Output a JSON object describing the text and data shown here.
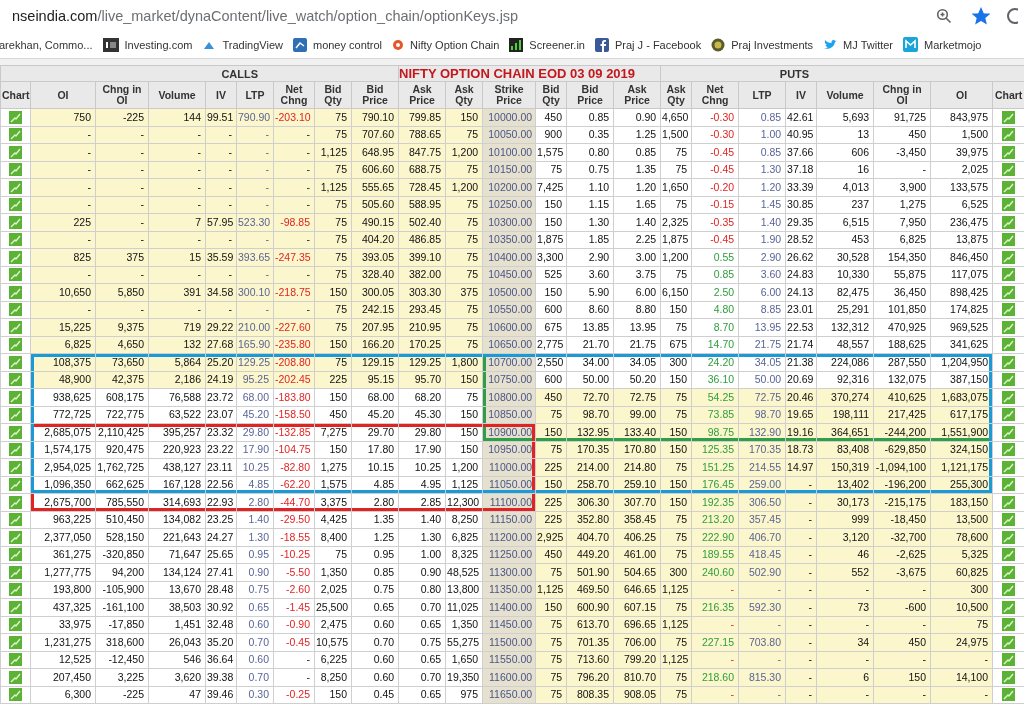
{
  "browser": {
    "url_host": "nseindia.com",
    "url_path": "/live_market/dynaContent/live_watch/option_chain/optionKeys.jsp",
    "bookmarked": true,
    "bookmarks": [
      "arekhan, Commo...",
      "Investing.com",
      "TradingView",
      "money control",
      "Nifty Option Chain",
      "Screener.in",
      "Praj J - Facebook",
      "Praj Investments",
      "MJ Twitter",
      "Marketmojo"
    ]
  },
  "table": {
    "calls_label": "CALLS",
    "title": "NIFTY OPTION CHAIN EOD 03 09 2019",
    "puts_label": "PUTS",
    "columns": [
      "Chart",
      "OI",
      "Chng in\nOI",
      "Volume",
      "IV",
      "LTP",
      "Net\nChng",
      "Bid\nQty",
      "Bid\nPrice",
      "Ask\nPrice",
      "Ask\nQty",
      "Strike\nPrice",
      "Bid\nQty",
      "Bid\nPrice",
      "Ask\nPrice",
      "Ask\nQty",
      "Net\nChng",
      "LTP",
      "IV",
      "Volume",
      "Chng in\nOI",
      "OI",
      "Chart"
    ],
    "rows": [
      {
        "calls_shaded": true,
        "puts_shaded": false,
        "call_net_red": true,
        "put_net_green": false,
        "outlined": [
          false,
          false,
          false
        ],
        "strike": "10000.00",
        "calls": [
          "750",
          "-225",
          "144",
          "99.51",
          "790.90",
          "-203.10",
          "75",
          "790.10",
          "799.85",
          "150"
        ],
        "puts": [
          "450",
          "0.85",
          "0.90",
          "4,650",
          "-0.30",
          "0.85",
          "42.61",
          "5,693",
          "91,725",
          "843,975"
        ]
      },
      {
        "calls_shaded": true,
        "puts_shaded": false,
        "call_net_red": false,
        "put_net_green": false,
        "outlined": [
          false,
          false,
          false
        ],
        "strike": "10050.00",
        "calls": [
          "-",
          "-",
          "-",
          "-",
          "-",
          "-",
          "75",
          "707.60",
          "788.65",
          "75"
        ],
        "puts": [
          "900",
          "0.35",
          "1.25",
          "1,500",
          "-0.30",
          "1.00",
          "40.95",
          "13",
          "450",
          "1,500"
        ]
      },
      {
        "calls_shaded": true,
        "puts_shaded": false,
        "call_net_red": false,
        "put_net_green": false,
        "outlined": [
          false,
          false,
          false
        ],
        "strike": "10100.00",
        "calls": [
          "-",
          "-",
          "-",
          "-",
          "-",
          "-",
          "1,125",
          "648.95",
          "847.75",
          "1,200"
        ],
        "puts": [
          "1,575",
          "0.80",
          "0.85",
          "75",
          "-0.45",
          "0.85",
          "37.66",
          "606",
          "-3,450",
          "39,975"
        ]
      },
      {
        "calls_shaded": true,
        "puts_shaded": false,
        "call_net_red": false,
        "put_net_green": false,
        "outlined": [
          false,
          false,
          false
        ],
        "strike": "10150.00",
        "calls": [
          "-",
          "-",
          "-",
          "-",
          "-",
          "-",
          "75",
          "606.60",
          "688.75",
          "75"
        ],
        "puts": [
          "75",
          "0.75",
          "1.35",
          "75",
          "-0.45",
          "1.30",
          "37.18",
          "16",
          "-",
          "2,025"
        ]
      },
      {
        "calls_shaded": true,
        "puts_shaded": false,
        "call_net_red": false,
        "put_net_green": false,
        "outlined": [
          false,
          false,
          false
        ],
        "strike": "10200.00",
        "calls": [
          "-",
          "-",
          "-",
          "-",
          "-",
          "-",
          "1,125",
          "555.65",
          "728.45",
          "1,200"
        ],
        "puts": [
          "7,425",
          "1.10",
          "1.20",
          "1,650",
          "-0.20",
          "1.20",
          "33.39",
          "4,013",
          "3,900",
          "133,575"
        ]
      },
      {
        "calls_shaded": true,
        "puts_shaded": false,
        "call_net_red": false,
        "put_net_green": false,
        "outlined": [
          false,
          false,
          false
        ],
        "strike": "10250.00",
        "calls": [
          "-",
          "-",
          "-",
          "-",
          "-",
          "-",
          "75",
          "505.60",
          "588.95",
          "75"
        ],
        "puts": [
          "150",
          "1.15",
          "1.65",
          "75",
          "-0.15",
          "1.45",
          "30.85",
          "237",
          "1,275",
          "6,525"
        ]
      },
      {
        "calls_shaded": true,
        "puts_shaded": false,
        "call_net_red": true,
        "put_net_green": false,
        "outlined": [
          false,
          false,
          false
        ],
        "strike": "10300.00",
        "calls": [
          "225",
          "-",
          "7",
          "57.95",
          "523.30",
          "-98.85",
          "75",
          "490.15",
          "502.40",
          "75"
        ],
        "puts": [
          "150",
          "1.30",
          "1.40",
          "2,325",
          "-0.35",
          "1.40",
          "29.35",
          "6,515",
          "7,950",
          "236,475"
        ]
      },
      {
        "calls_shaded": true,
        "puts_shaded": false,
        "call_net_red": false,
        "put_net_green": false,
        "outlined": [
          false,
          false,
          false
        ],
        "strike": "10350.00",
        "calls": [
          "-",
          "-",
          "-",
          "-",
          "-",
          "-",
          "75",
          "404.20",
          "486.85",
          "75"
        ],
        "puts": [
          "1,875",
          "1.85",
          "2.25",
          "1,875",
          "-0.45",
          "1.90",
          "28.52",
          "453",
          "6,825",
          "13,875"
        ]
      },
      {
        "calls_shaded": true,
        "puts_shaded": false,
        "call_net_red": true,
        "put_net_green": true,
        "outlined": [
          false,
          false,
          false
        ],
        "strike": "10400.00",
        "calls": [
          "825",
          "375",
          "15",
          "35.59",
          "393.65",
          "-247.35",
          "75",
          "393.05",
          "399.10",
          "75"
        ],
        "puts": [
          "3,300",
          "2.90",
          "3.00",
          "1,200",
          "0.55",
          "2.90",
          "26.62",
          "30,528",
          "154,350",
          "846,450"
        ]
      },
      {
        "calls_shaded": true,
        "puts_shaded": false,
        "call_net_red": false,
        "put_net_green": true,
        "outlined": [
          false,
          false,
          false
        ],
        "strike": "10450.00",
        "calls": [
          "-",
          "-",
          "-",
          "-",
          "-",
          "-",
          "75",
          "328.40",
          "382.00",
          "75"
        ],
        "puts": [
          "525",
          "3.60",
          "3.75",
          "75",
          "0.85",
          "3.60",
          "24.83",
          "10,330",
          "55,875",
          "117,075"
        ]
      },
      {
        "calls_shaded": true,
        "puts_shaded": false,
        "call_net_red": true,
        "put_net_green": true,
        "outlined": [
          false,
          false,
          false
        ],
        "strike": "10500.00",
        "calls": [
          "10,650",
          "5,850",
          "391",
          "34.58",
          "300.10",
          "-218.75",
          "150",
          "300.05",
          "303.30",
          "375"
        ],
        "puts": [
          "150",
          "5.90",
          "6.00",
          "6,150",
          "2.50",
          "6.00",
          "24.13",
          "82,475",
          "36,450",
          "898,425"
        ]
      },
      {
        "calls_shaded": true,
        "puts_shaded": false,
        "call_net_red": false,
        "put_net_green": true,
        "outlined": [
          false,
          false,
          false
        ],
        "strike": "10550.00",
        "calls": [
          "-",
          "-",
          "-",
          "-",
          "-",
          "-",
          "75",
          "242.15",
          "293.45",
          "75"
        ],
        "puts": [
          "600",
          "8.60",
          "8.80",
          "150",
          "4.80",
          "8.85",
          "23.01",
          "25,291",
          "101,850",
          "174,825"
        ]
      },
      {
        "calls_shaded": true,
        "puts_shaded": false,
        "call_net_red": true,
        "put_net_green": true,
        "outlined": [
          false,
          false,
          false
        ],
        "strike": "10600.00",
        "calls": [
          "15,225",
          "9,375",
          "719",
          "29.22",
          "210.00",
          "-227.60",
          "75",
          "207.95",
          "210.95",
          "75"
        ],
        "puts": [
          "675",
          "13.85",
          "13.95",
          "75",
          "8.70",
          "13.95",
          "22.53",
          "132,312",
          "470,925",
          "969,525"
        ]
      },
      {
        "calls_shaded": true,
        "puts_shaded": false,
        "call_net_red": true,
        "put_net_green": true,
        "outlined": [
          false,
          false,
          false
        ],
        "strike": "10650.00",
        "calls": [
          "6,825",
          "4,650",
          "132",
          "27.68",
          "165.90",
          "-235.80",
          "150",
          "166.20",
          "170.25",
          "75"
        ],
        "puts": [
          "2,775",
          "21.70",
          "21.75",
          "675",
          "14.70",
          "21.75",
          "21.74",
          "48,557",
          "188,625",
          "341,625"
        ]
      },
      {
        "calls_shaded": true,
        "puts_shaded": false,
        "call_net_red": true,
        "put_net_green": true,
        "outlined": [
          true,
          false,
          true
        ],
        "strike": "10700.00",
        "calls": [
          "108,375",
          "73,650",
          "5,864",
          "25.20",
          "129.25",
          "-208.80",
          "75",
          "129.15",
          "129.25",
          "1,800"
        ],
        "puts": [
          "2,550",
          "34.00",
          "34.05",
          "300",
          "24.20",
          "34.05",
          "21.38",
          "224,086",
          "287,550",
          "1,204,950"
        ]
      },
      {
        "calls_shaded": true,
        "puts_shaded": false,
        "call_net_red": true,
        "put_net_green": true,
        "outlined": [
          true,
          false,
          true
        ],
        "strike": "10750.00",
        "calls": [
          "48,900",
          "42,375",
          "2,186",
          "24.19",
          "95.25",
          "-202.45",
          "225",
          "95.15",
          "95.70",
          "150"
        ],
        "puts": [
          "600",
          "50.00",
          "50.20",
          "150",
          "36.10",
          "50.00",
          "20.69",
          "92,316",
          "132,075",
          "387,150"
        ]
      },
      {
        "calls_shaded": false,
        "puts_shaded": true,
        "call_net_red": true,
        "put_net_green": true,
        "outlined": [
          true,
          false,
          true
        ],
        "strike": "10800.00",
        "calls": [
          "938,625",
          "608,175",
          "76,588",
          "23.72",
          "68.00",
          "-183.80",
          "150",
          "68.00",
          "68.20",
          "75"
        ],
        "puts": [
          "450",
          "72.70",
          "72.75",
          "75",
          "54.25",
          "72.75",
          "20.46",
          "370,274",
          "410,625",
          "1,683,075"
        ]
      },
      {
        "calls_shaded": false,
        "puts_shaded": true,
        "call_net_red": true,
        "put_net_green": true,
        "outlined": [
          true,
          false,
          true
        ],
        "strike": "10850.00",
        "calls": [
          "772,725",
          "722,775",
          "63,522",
          "23.07",
          "45.20",
          "-158.50",
          "450",
          "45.20",
          "45.30",
          "150"
        ],
        "puts": [
          "75",
          "98.70",
          "99.00",
          "75",
          "73.85",
          "98.70",
          "19.65",
          "198,111",
          "217,425",
          "617,175"
        ]
      },
      {
        "calls_shaded": false,
        "puts_shaded": true,
        "call_net_red": true,
        "put_net_green": true,
        "outlined": [
          true,
          true,
          true
        ],
        "strike": "10900.00",
        "calls": [
          "2,685,075",
          "2,110,425",
          "395,257",
          "23.32",
          "29.80",
          "-132.85",
          "7,275",
          "29.70",
          "29.80",
          "150"
        ],
        "puts": [
          "150",
          "132.95",
          "133.40",
          "150",
          "98.75",
          "132.90",
          "19.16",
          "364,651",
          "-244,200",
          "1,551,900"
        ]
      },
      {
        "calls_shaded": false,
        "puts_shaded": true,
        "call_net_red": true,
        "put_net_green": true,
        "outlined": [
          true,
          true,
          false
        ],
        "strike": "10950.00",
        "calls": [
          "1,574,175",
          "920,475",
          "220,923",
          "23.22",
          "17.90",
          "-104.75",
          "150",
          "17.80",
          "17.90",
          "150"
        ],
        "puts": [
          "75",
          "170.35",
          "170.80",
          "150",
          "125.35",
          "170.35",
          "18.73",
          "83,408",
          "-629,850",
          "324,150"
        ]
      },
      {
        "calls_shaded": false,
        "puts_shaded": true,
        "call_net_red": true,
        "put_net_green": true,
        "outlined": [
          true,
          true,
          false
        ],
        "strike": "11000.00",
        "calls": [
          "2,954,025",
          "1,762,725",
          "438,127",
          "23.11",
          "10.25",
          "-82.80",
          "1,275",
          "10.15",
          "10.25",
          "1,200"
        ],
        "puts": [
          "225",
          "214.00",
          "214.80",
          "75",
          "151.25",
          "214.55",
          "14.97",
          "150,319",
          "-1,094,100",
          "1,121,175"
        ]
      },
      {
        "calls_shaded": false,
        "puts_shaded": true,
        "call_net_red": true,
        "put_net_green": true,
        "outlined": [
          true,
          true,
          false
        ],
        "strike": "11050.00",
        "calls": [
          "1,096,350",
          "662,625",
          "167,128",
          "22.56",
          "4.85",
          "-62.20",
          "1,575",
          "4.85",
          "4.95",
          "1,125"
        ],
        "puts": [
          "150",
          "258.70",
          "259.10",
          "150",
          "176.45",
          "259.00",
          "-",
          "13,402",
          "-196,200",
          "255,300"
        ]
      },
      {
        "calls_shaded": false,
        "puts_shaded": true,
        "call_net_red": true,
        "put_net_green": true,
        "outlined": [
          false,
          true,
          false
        ],
        "strike": "11100.00",
        "calls": [
          "2,675,700",
          "785,550",
          "314,693",
          "22.93",
          "2.80",
          "-44.70",
          "3,375",
          "2.80",
          "2.85",
          "12,300"
        ],
        "puts": [
          "225",
          "306.30",
          "307.70",
          "150",
          "192.35",
          "306.50",
          "-",
          "30,173",
          "-215,175",
          "183,150"
        ]
      },
      {
        "calls_shaded": false,
        "puts_shaded": true,
        "call_net_red": true,
        "put_net_green": true,
        "outlined": [
          false,
          false,
          false
        ],
        "strike": "11150.00",
        "calls": [
          "963,225",
          "510,450",
          "134,082",
          "23.25",
          "1.40",
          "-29.50",
          "4,425",
          "1.35",
          "1.40",
          "8,250"
        ],
        "puts": [
          "225",
          "352.80",
          "358.45",
          "75",
          "213.20",
          "357.45",
          "-",
          "999",
          "-18,450",
          "13,500"
        ]
      },
      {
        "calls_shaded": false,
        "puts_shaded": true,
        "call_net_red": true,
        "put_net_green": true,
        "outlined": [
          false,
          false,
          false
        ],
        "strike": "11200.00",
        "calls": [
          "2,377,050",
          "528,150",
          "221,643",
          "24.27",
          "1.30",
          "-18.55",
          "8,400",
          "1.25",
          "1.30",
          "6,825"
        ],
        "puts": [
          "2,925",
          "404.70",
          "406.25",
          "75",
          "222.90",
          "406.70",
          "-",
          "3,120",
          "-32,700",
          "78,600"
        ]
      },
      {
        "calls_shaded": false,
        "puts_shaded": true,
        "call_net_red": true,
        "put_net_green": true,
        "outlined": [
          false,
          false,
          false
        ],
        "strike": "11250.00",
        "calls": [
          "361,275",
          "-320,850",
          "71,647",
          "25.65",
          "0.95",
          "-10.25",
          "75",
          "0.95",
          "1.00",
          "8,325"
        ],
        "puts": [
          "450",
          "449.20",
          "461.00",
          "75",
          "189.55",
          "418.45",
          "-",
          "46",
          "-2,625",
          "5,325"
        ]
      },
      {
        "calls_shaded": false,
        "puts_shaded": true,
        "call_net_red": true,
        "put_net_green": true,
        "outlined": [
          false,
          false,
          false
        ],
        "strike": "11300.00",
        "calls": [
          "1,277,775",
          "94,200",
          "134,124",
          "27.41",
          "0.90",
          "-5.50",
          "1,350",
          "0.85",
          "0.90",
          "48,525"
        ],
        "puts": [
          "75",
          "501.90",
          "504.65",
          "300",
          "240.60",
          "502.90",
          "-",
          "552",
          "-3,675",
          "60,825"
        ]
      },
      {
        "calls_shaded": false,
        "puts_shaded": true,
        "call_net_red": true,
        "put_net_green": false,
        "outlined": [
          false,
          false,
          false
        ],
        "strike": "11350.00",
        "calls": [
          "193,800",
          "-105,900",
          "13,670",
          "28.48",
          "0.75",
          "-2.60",
          "2,025",
          "0.75",
          "0.80",
          "13,800"
        ],
        "puts": [
          "1,125",
          "469.50",
          "646.65",
          "1,125",
          "-",
          "-",
          "-",
          "-",
          "-",
          "300"
        ]
      },
      {
        "calls_shaded": false,
        "puts_shaded": true,
        "call_net_red": true,
        "put_net_green": true,
        "outlined": [
          false,
          false,
          false
        ],
        "strike": "11400.00",
        "calls": [
          "437,325",
          "-161,100",
          "38,503",
          "30.92",
          "0.65",
          "-1.45",
          "25,500",
          "0.65",
          "0.70",
          "11,025"
        ],
        "puts": [
          "150",
          "600.90",
          "607.15",
          "75",
          "216.35",
          "592.30",
          "-",
          "73",
          "-600",
          "10,500"
        ]
      },
      {
        "calls_shaded": false,
        "puts_shaded": true,
        "call_net_red": true,
        "put_net_green": false,
        "outlined": [
          false,
          false,
          false
        ],
        "strike": "11450.00",
        "calls": [
          "33,975",
          "-17,850",
          "1,451",
          "32.48",
          "0.60",
          "-0.90",
          "2,475",
          "0.60",
          "0.65",
          "1,350"
        ],
        "puts": [
          "75",
          "613.70",
          "696.65",
          "1,125",
          "-",
          "-",
          "-",
          "-",
          "-",
          "75"
        ]
      },
      {
        "calls_shaded": false,
        "puts_shaded": true,
        "call_net_red": true,
        "put_net_green": true,
        "outlined": [
          false,
          false,
          false
        ],
        "strike": "11500.00",
        "calls": [
          "1,231,275",
          "318,600",
          "26,043",
          "35.20",
          "0.70",
          "-0.45",
          "10,575",
          "0.70",
          "0.75",
          "55,275"
        ],
        "puts": [
          "75",
          "701.35",
          "706.00",
          "75",
          "227.15",
          "703.80",
          "-",
          "34",
          "450",
          "24,975"
        ]
      },
      {
        "calls_shaded": false,
        "puts_shaded": true,
        "call_net_red": false,
        "put_net_green": false,
        "outlined": [
          false,
          false,
          false
        ],
        "strike": "11550.00",
        "calls": [
          "12,525",
          "-12,450",
          "546",
          "36.64",
          "0.60",
          "-",
          "6,225",
          "0.60",
          "0.65",
          "1,650"
        ],
        "puts": [
          "75",
          "713.60",
          "799.20",
          "1,125",
          "-",
          "-",
          "-",
          "-",
          "-",
          "-"
        ]
      },
      {
        "calls_shaded": false,
        "puts_shaded": true,
        "call_net_red": false,
        "put_net_green": true,
        "outlined": [
          false,
          false,
          false
        ],
        "strike": "11600.00",
        "calls": [
          "207,450",
          "3,225",
          "3,620",
          "39.38",
          "0.70",
          "-",
          "8,250",
          "0.60",
          "0.70",
          "19,350"
        ],
        "puts": [
          "75",
          "796.20",
          "810.70",
          "75",
          "218.60",
          "815.30",
          "-",
          "6",
          "150",
          "14,100"
        ]
      },
      {
        "calls_shaded": false,
        "puts_shaded": true,
        "call_net_red": true,
        "put_net_green": false,
        "outlined": [
          false,
          false,
          false
        ],
        "strike": "11650.00",
        "calls": [
          "6,300",
          "-225",
          "47",
          "39.46",
          "0.30",
          "-0.25",
          "150",
          "0.45",
          "0.65",
          "975"
        ],
        "puts": [
          "75",
          "808.35",
          "908.05",
          "75",
          "-",
          "-",
          "-",
          "-",
          "-",
          "-"
        ]
      }
    ]
  }
}
